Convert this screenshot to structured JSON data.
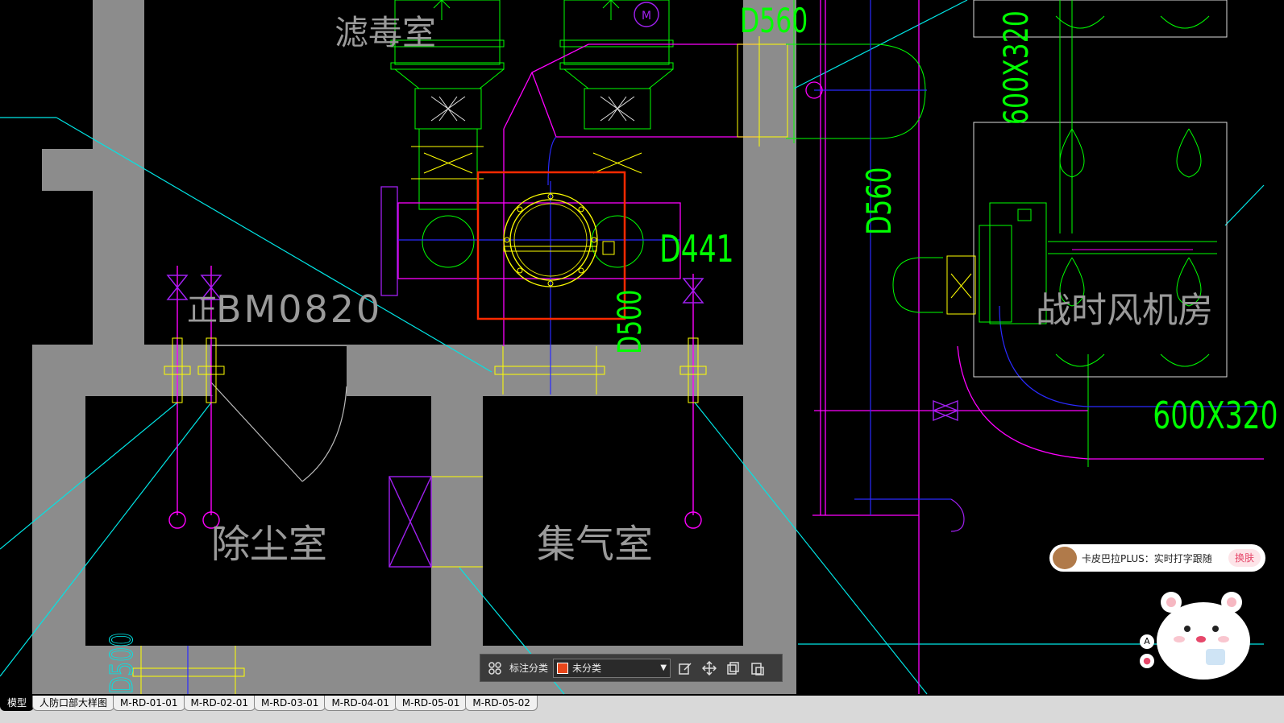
{
  "rooms": {
    "filter_room": "滤毒室",
    "dust_room": "除尘室",
    "gas_room": "集气室",
    "fan_room": "战时风机房"
  },
  "dims": {
    "top_d560": "D560",
    "side_d560": "D560",
    "d441": "D441",
    "vert_d500": "D500",
    "duct_600x320_top": "600X320",
    "duct_600x320_right": "600X320",
    "bm0820": "BM0820",
    "bottom_left": "D500"
  },
  "motor_label": "M",
  "annotation_bar": {
    "category_label": "标注分类",
    "category_value": "未分类",
    "swatch_color": "#e8461a"
  },
  "tabs": [
    "模型",
    "人防口部大样图",
    "M-RD-01-01",
    "M-RD-02-01",
    "M-RD-03-01",
    "M-RD-04-01",
    "M-RD-05-01",
    "M-RD-05-02"
  ],
  "ime": {
    "text": "卡皮巴拉PLUS：实时打字跟随",
    "skin_button": "换肤",
    "mode_letter": "A"
  },
  "colors": {
    "wall": "#8c8c8c",
    "green": "#00ff00",
    "yellow": "#ffff00",
    "magenta": "#ff00ff",
    "cyan": "#00ffff",
    "blue": "#0000ff",
    "red": "#ff2a00"
  }
}
